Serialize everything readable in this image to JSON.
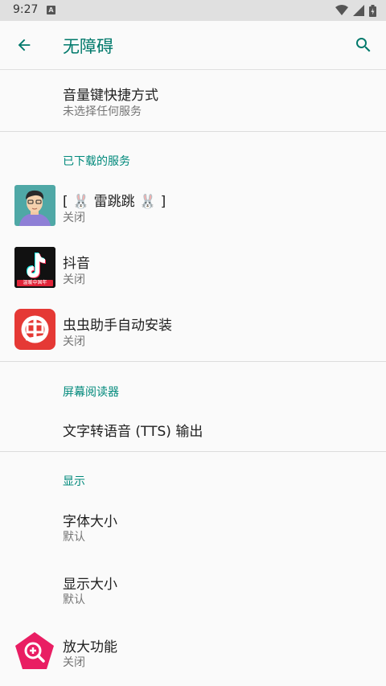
{
  "status_bar": {
    "time": "9:27",
    "notification_badge": "A",
    "icons": [
      "wifi-icon",
      "signal-icon",
      "battery-icon"
    ]
  },
  "app_bar": {
    "title": "无障碍",
    "back_icon": "arrow-back-icon",
    "search_icon": "search-icon"
  },
  "shortcut": {
    "title": "音量键快捷方式",
    "summary": "未选择任何服务"
  },
  "downloaded": {
    "header": "已下载的服务",
    "items": [
      {
        "title": "[ 🐰 雷跳跳 🐰 ]",
        "summary": "关闭"
      },
      {
        "title": "抖音",
        "summary": "关闭",
        "badge": "温暖中国年"
      },
      {
        "title": "虫虫助手自动安装",
        "summary": "关闭"
      }
    ]
  },
  "screen_reader": {
    "header": "屏幕阅读器",
    "tts": "文字转语音 (TTS) 输出"
  },
  "display": {
    "header": "显示",
    "items": [
      {
        "title": "字体大小",
        "summary": "默认"
      },
      {
        "title": "显示大小",
        "summary": "默认"
      },
      {
        "title": "放大功能",
        "summary": "关闭"
      }
    ]
  },
  "colors": {
    "accent": "#00897b",
    "title": "#00796b",
    "magnifier": "#e91e63",
    "bug_app": "#e53935",
    "douyin_bg": "#111111"
  }
}
